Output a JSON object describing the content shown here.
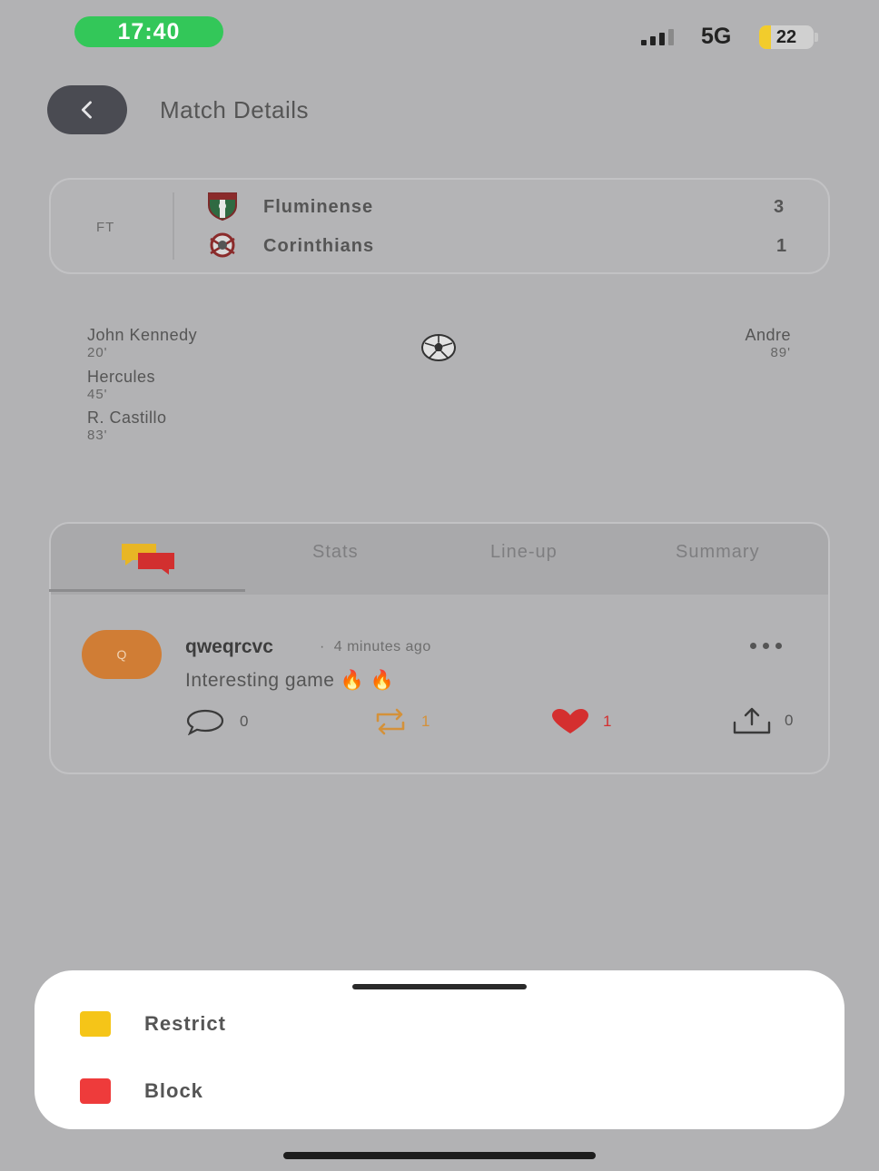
{
  "status_bar": {
    "time": "17:40",
    "network": "5G",
    "battery_level": "22",
    "battery_fraction": 0.22,
    "time_pill_color": "#33c759"
  },
  "header": {
    "back_icon": "chevron-left-icon",
    "title": "Match Details"
  },
  "match": {
    "status": "FT",
    "home": {
      "name": "Fluminense",
      "score": "3",
      "crest_icon": "fluminense-crest-icon"
    },
    "away": {
      "name": "Corinthians",
      "score": "1",
      "crest_icon": "corinthians-crest-icon"
    }
  },
  "goals": {
    "icon": "soccer-ball-icon",
    "home": [
      {
        "player": "John Kennedy",
        "minute": "20'"
      },
      {
        "player": "Hercules",
        "minute": "45'"
      },
      {
        "player": "R. Castillo",
        "minute": "83'"
      }
    ],
    "away": [
      {
        "player": "Andre",
        "minute": "89'"
      }
    ]
  },
  "tabs": {
    "active_icon": "chat-bubbles-icon",
    "items": [
      "Stats",
      "Line-up",
      "Summary"
    ]
  },
  "comment": {
    "avatar_letter": "Q",
    "avatar_color": "#d07d35",
    "username": "qweqrcvc",
    "separator": "·",
    "time": "4 minutes ago",
    "text": "Interesting game 🔥 🔥",
    "actions": {
      "reply_count": "0",
      "repost_count": "1",
      "like_count": "1",
      "share_count": "0"
    },
    "repost_color": "#d4913a",
    "like_color": "#d42f2f"
  },
  "sheet": {
    "options": [
      {
        "label": "Restrict",
        "color": "#f5c518"
      },
      {
        "label": "Block",
        "color": "#ee3b3b"
      }
    ]
  }
}
